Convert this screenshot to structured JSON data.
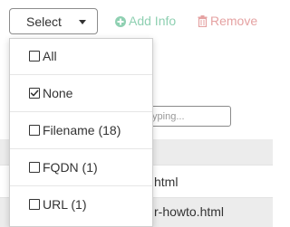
{
  "toolbar": {
    "select_label": "Select",
    "add_info_label": "Add Info",
    "remove_label": "Remove",
    "add_info_color": "#8fd0b2",
    "remove_color": "#e5a2a2",
    "add_info_icon": "plus-circle-icon",
    "remove_icon": "trash-icon"
  },
  "dropdown": {
    "items": [
      {
        "label": "All",
        "checked": false
      },
      {
        "label": "None",
        "checked": true
      },
      {
        "label": "Filename (18)",
        "checked": false
      },
      {
        "label": "FQDN (1)",
        "checked": false
      },
      {
        "label": "URL (1)",
        "checked": false
      }
    ]
  },
  "table": {
    "filter_placeholder": "typing...",
    "rows": [
      {
        "text": ""
      },
      {
        "text": "html"
      },
      {
        "text": "r-howto.html"
      }
    ]
  }
}
